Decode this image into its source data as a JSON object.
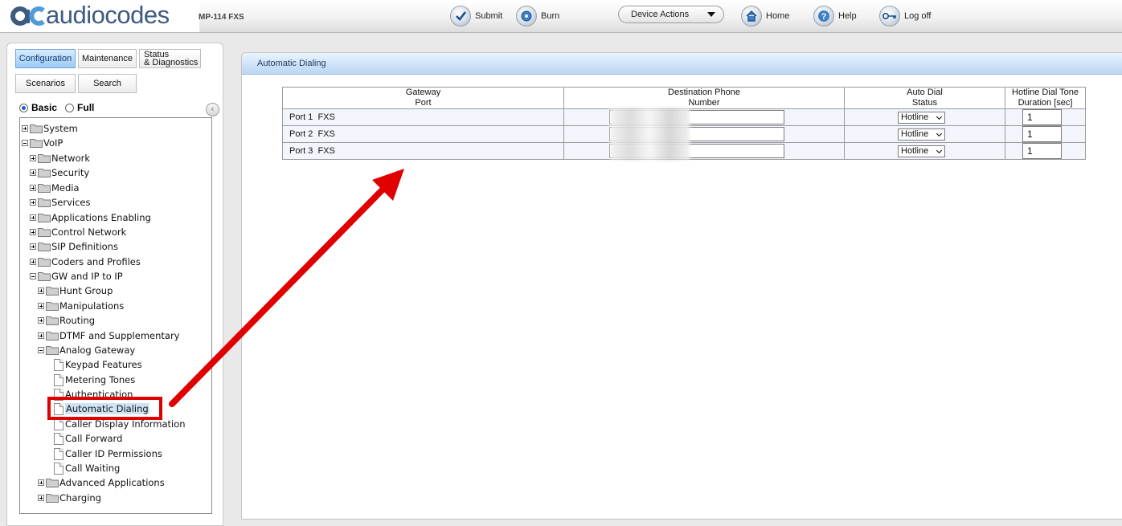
{
  "header": {
    "logo_text": "audiocodes",
    "product": "MP-114 FXS",
    "submit_label": "Submit",
    "burn_label": "Burn",
    "device_actions_label": "Device Actions",
    "home_label": "Home",
    "help_label": "Help",
    "logoff_label": "Log off"
  },
  "nav_tabs": {
    "configuration": "Configuration",
    "maintenance": "Maintenance",
    "status_line1": "Status",
    "status_line2": "& Diagnostics",
    "scenarios": "Scenarios",
    "search": "Search"
  },
  "view_mode": {
    "basic": "Basic",
    "full": "Full",
    "selected": "Basic"
  },
  "tree": {
    "system": "System",
    "voip": "VoIP",
    "network": "Network",
    "security": "Security",
    "media": "Media",
    "services": "Services",
    "applications_enabling": "Applications Enabling",
    "control_network": "Control Network",
    "sip_definitions": "SIP Definitions",
    "coders_profiles": "Coders and Profiles",
    "gw_ip_to_ip": "GW and IP to IP",
    "hunt_group": "Hunt Group",
    "manipulations": "Manipulations",
    "routing": "Routing",
    "dtmf": "DTMF and Supplementary",
    "analog_gateway": "Analog Gateway",
    "keypad_features": "Keypad Features",
    "metering_tones": "Metering Tones",
    "authentication": "Authentication",
    "automatic_dialing": "Automatic Dialing",
    "caller_display": "Caller Display Information",
    "call_forward": "Call Forward",
    "caller_id_permissions": "Caller ID Permissions",
    "call_waiting": "Call Waiting",
    "advanced_applications": "Advanced Applications",
    "charging": "Charging"
  },
  "main": {
    "title": "Automatic Dialing",
    "columns": {
      "port_l1": "Gateway",
      "port_l2": "Port",
      "dest_l1": "Destination Phone",
      "dest_l2": "Number",
      "auto_l1": "Auto Dial",
      "auto_l2": "Status",
      "hot_l1": "Hotline Dial Tone",
      "hot_l2": "Duration [sec]"
    },
    "rows": [
      {
        "port": "Port 1  FXS",
        "status": "Hotline",
        "duration": "1"
      },
      {
        "port": "Port 2  FXS",
        "status": "Hotline",
        "duration": "1"
      },
      {
        "port": "Port 3  FXS",
        "status": "Hotline",
        "duration": "1"
      }
    ]
  },
  "colors": {
    "annotation_red": "#e00000",
    "accent_blue": "#3d5a80",
    "header_blue": "#cfe3f8"
  }
}
